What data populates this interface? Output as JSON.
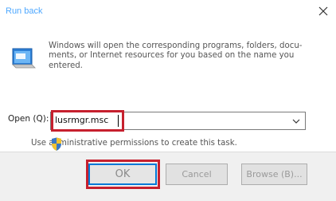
{
  "window": {
    "title": "Run back",
    "close_icon": "close-icon"
  },
  "dialog": {
    "app_icon": "run-icon",
    "description": "Windows will open the corresponding programs, folders, docu-ments, or Internet resources for you based on the name you entered.",
    "open_label": "Open (Q):",
    "command_value": "lusrmgr.msc",
    "dropdown_icon": "chevron-down-icon",
    "admin_icon": "shield-icon",
    "admin_text": "Use administrative permissions to create this task."
  },
  "buttons": {
    "ok": "OK",
    "cancel": "Cancel",
    "browse": "Browse (B)..."
  },
  "colors": {
    "title": "#4ea8ff",
    "highlight": "#c6202e",
    "focus": "#0078d7"
  }
}
